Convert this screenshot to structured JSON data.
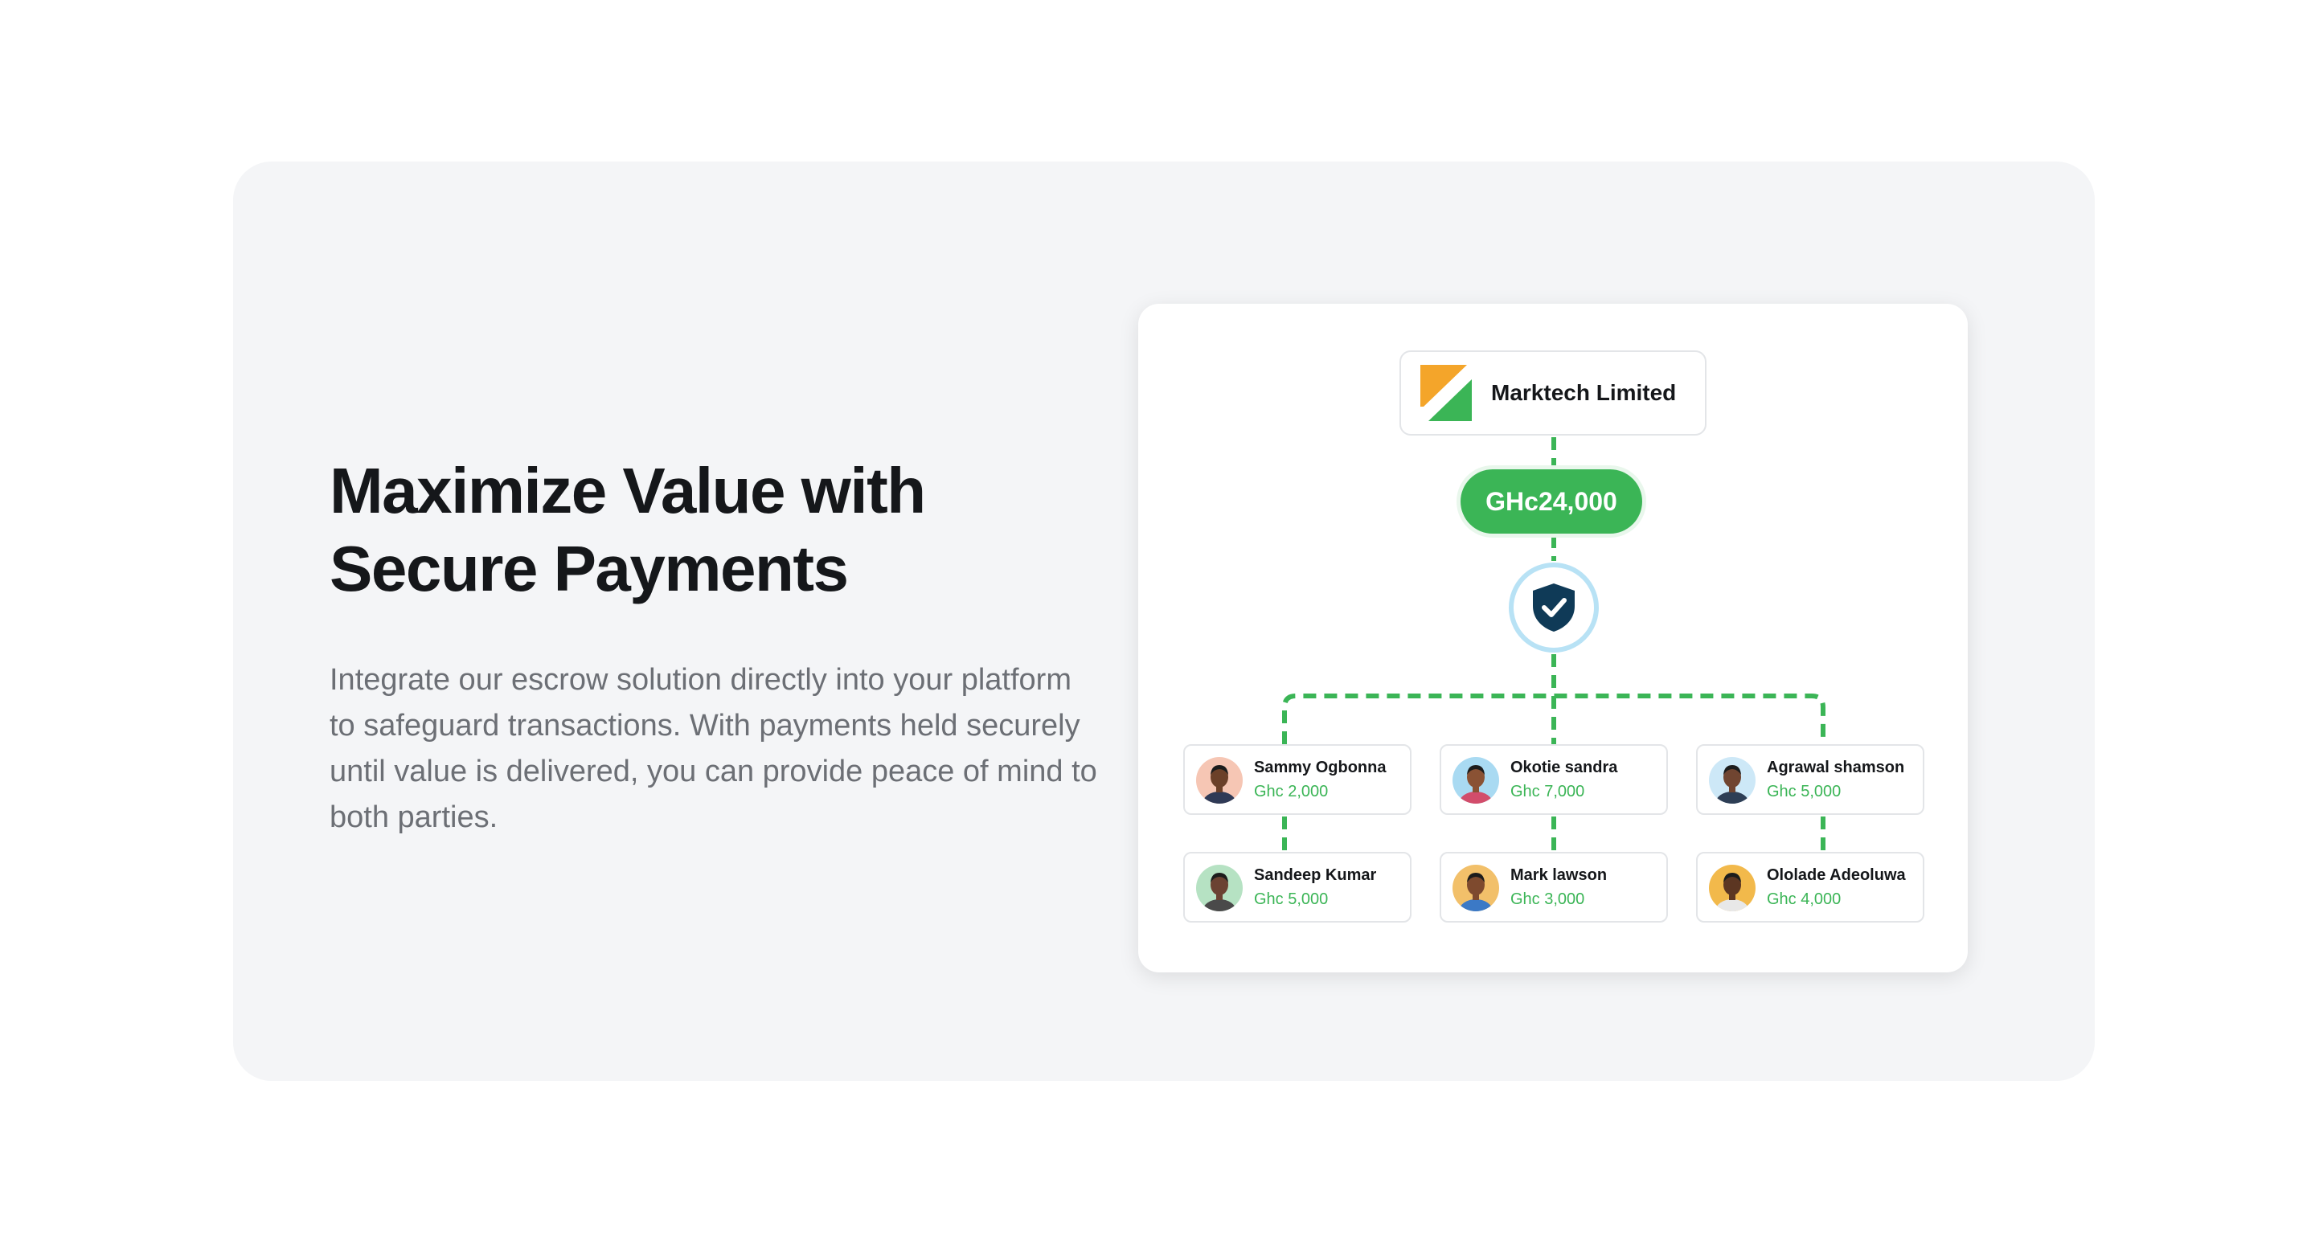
{
  "headline": "Maximize Value with Secure Payments",
  "description": "Integrate our escrow solution directly into your platform to safeguard transactions. With payments held securely until value is delivered, you can provide peace of mind to both parties.",
  "diagram": {
    "company_name": "Marktech Limited",
    "total_amount": "GHc24,000",
    "shield_icon": "shield-check-icon",
    "recipients": [
      {
        "name": "Sammy Ogbonna",
        "amount": "Ghc 2,000",
        "avatar_bg": "#f6c6b4",
        "skin": "#6b4029",
        "shirt": "#2f3a56"
      },
      {
        "name": "Okotie sandra",
        "amount": "Ghc 7,000",
        "avatar_bg": "#a9daf2",
        "skin": "#8a5234",
        "shirt": "#d24d6b"
      },
      {
        "name": "Agrawal shamson",
        "amount": "Ghc 5,000",
        "avatar_bg": "#cde8f7",
        "skin": "#704531",
        "shirt": "#2d3e55"
      },
      {
        "name": "Sandeep Kumar",
        "amount": "Ghc 5,000",
        "avatar_bg": "#b6e2c3",
        "skin": "#6b4232",
        "shirt": "#4a4a4a"
      },
      {
        "name": "Mark lawson",
        "amount": "Ghc 3,000",
        "avatar_bg": "#f2c06a",
        "skin": "#7e4a2e",
        "shirt": "#3b79c6"
      },
      {
        "name": "Ololade Adeoluwa",
        "amount": "Ghc 4,000",
        "avatar_bg": "#f2b94b",
        "skin": "#5c3622",
        "shirt": "#e8e8e8"
      }
    ]
  },
  "colors": {
    "accent_green": "#3bb556",
    "shield_navy": "#0f3a57",
    "ring_blue": "#b8e2f5",
    "logo_orange": "#f4a52a",
    "section_bg": "#f4f5f7"
  }
}
